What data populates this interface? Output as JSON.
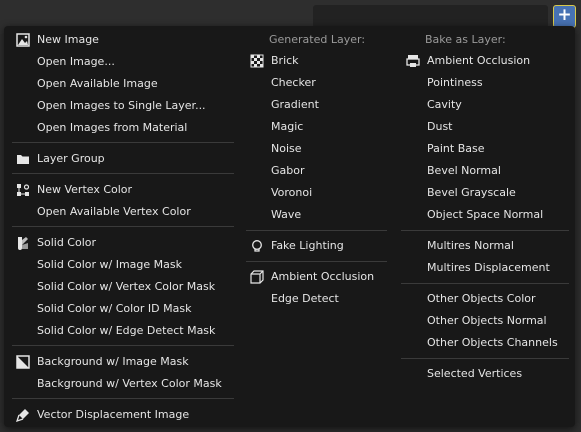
{
  "toolbar": {
    "add_button_label": "+"
  },
  "menu": {
    "col1": {
      "items": [
        {
          "label": "New Image",
          "icon": "image-icon"
        },
        {
          "label": "Open Image..."
        },
        {
          "label": "Open Available Image"
        },
        {
          "label": "Open Images to Single Layer..."
        },
        {
          "label": "Open Images from Material"
        },
        {
          "label": "Layer Group",
          "icon": "folder-icon"
        },
        {
          "label": "New Vertex Color",
          "icon": "vertex-color-icon"
        },
        {
          "label": "Open Available Vertex Color"
        },
        {
          "label": "Solid Color",
          "icon": "solid-color-icon"
        },
        {
          "label": "Solid Color w/ Image Mask"
        },
        {
          "label": "Solid Color w/ Vertex Color Mask"
        },
        {
          "label": "Solid Color w/ Color ID Mask"
        },
        {
          "label": "Solid Color w/ Edge Detect Mask"
        },
        {
          "label": "Background w/ Image Mask",
          "icon": "background-icon"
        },
        {
          "label": "Background w/ Vertex Color Mask"
        },
        {
          "label": "Vector Displacement Image",
          "icon": "brush-icon"
        }
      ]
    },
    "col2": {
      "header": "Generated Layer:",
      "items": [
        {
          "label": "Brick",
          "icon": "checker-icon"
        },
        {
          "label": "Checker"
        },
        {
          "label": "Gradient"
        },
        {
          "label": "Magic"
        },
        {
          "label": "Noise"
        },
        {
          "label": "Gabor"
        },
        {
          "label": "Voronoi"
        },
        {
          "label": "Wave"
        },
        {
          "label": "Fake Lighting",
          "icon": "light-bulb-icon"
        },
        {
          "label": "Ambient Occlusion",
          "icon": "cube-icon"
        },
        {
          "label": "Edge Detect"
        }
      ]
    },
    "col3": {
      "header": "Bake as Layer:",
      "items": [
        {
          "label": "Ambient Occlusion",
          "icon": "bake-icon"
        },
        {
          "label": "Pointiness"
        },
        {
          "label": "Cavity"
        },
        {
          "label": "Dust"
        },
        {
          "label": "Paint Base"
        },
        {
          "label": "Bevel Normal"
        },
        {
          "label": "Bevel Grayscale"
        },
        {
          "label": "Object Space Normal"
        },
        {
          "label": "Multires Normal"
        },
        {
          "label": "Multires Displacement"
        },
        {
          "label": "Other Objects Color"
        },
        {
          "label": "Other Objects Normal"
        },
        {
          "label": "Other Objects Channels"
        },
        {
          "label": "Selected Vertices"
        }
      ]
    }
  }
}
